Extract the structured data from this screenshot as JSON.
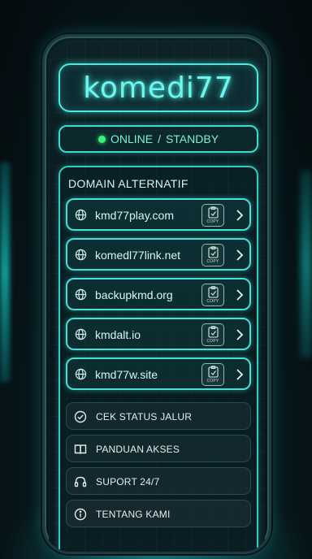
{
  "app": {
    "logo": "komedi77"
  },
  "status": {
    "online": "ONLINE",
    "separator": " / ",
    "standby": "STANDBY"
  },
  "domains": {
    "title": "DOMAIN ALTERNATIF",
    "copy_label": "COPY",
    "items": [
      {
        "name": "kmd77play.com"
      },
      {
        "name": "komedl77link.net"
      },
      {
        "name": "backupkmd.org"
      },
      {
        "name": "kmdalt.io"
      },
      {
        "name": "kmd77w.site"
      }
    ]
  },
  "menu": {
    "items": [
      {
        "label": "CEK STATUS JALUR",
        "icon": "check-circle-icon"
      },
      {
        "label": "PANDUAN AKSES",
        "icon": "book-icon"
      },
      {
        "label": "SUPORT 24/7",
        "icon": "headset-icon"
      },
      {
        "label": "TENTANG KAMI",
        "icon": "info-icon"
      }
    ]
  },
  "colors": {
    "accent": "#4de8e0",
    "status": "#39f07a",
    "background": "#071a1e"
  }
}
